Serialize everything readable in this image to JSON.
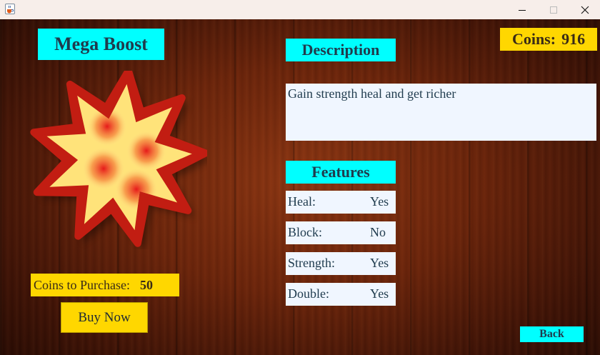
{
  "window": {
    "icons": {
      "app": "java-cup-icon",
      "minimize": "minimize-icon",
      "maximize": "maximize-icon",
      "close": "close-icon"
    }
  },
  "product": {
    "name": "Mega Boost",
    "image_icon": "explosion-star-icon"
  },
  "coins": {
    "label": "Coins:",
    "value": "916"
  },
  "description": {
    "header": "Description",
    "text": "Gain strength heal and get richer"
  },
  "features": {
    "header": "Features",
    "items": [
      {
        "name": "Heal:",
        "value": "Yes"
      },
      {
        "name": "Block:",
        "value": "No"
      },
      {
        "name": "Strength:",
        "value": "Yes"
      },
      {
        "name": "Double:",
        "value": "Yes"
      }
    ]
  },
  "purchase": {
    "label": "Coins to Purchase:",
    "amount": "50",
    "buy_label": "Buy Now"
  },
  "navigation": {
    "back_label": "Back"
  },
  "colors": {
    "cyan": "#00ffff",
    "gold": "#ffd700",
    "panel": "#f0f6ff",
    "text": "#1f3b4d"
  }
}
